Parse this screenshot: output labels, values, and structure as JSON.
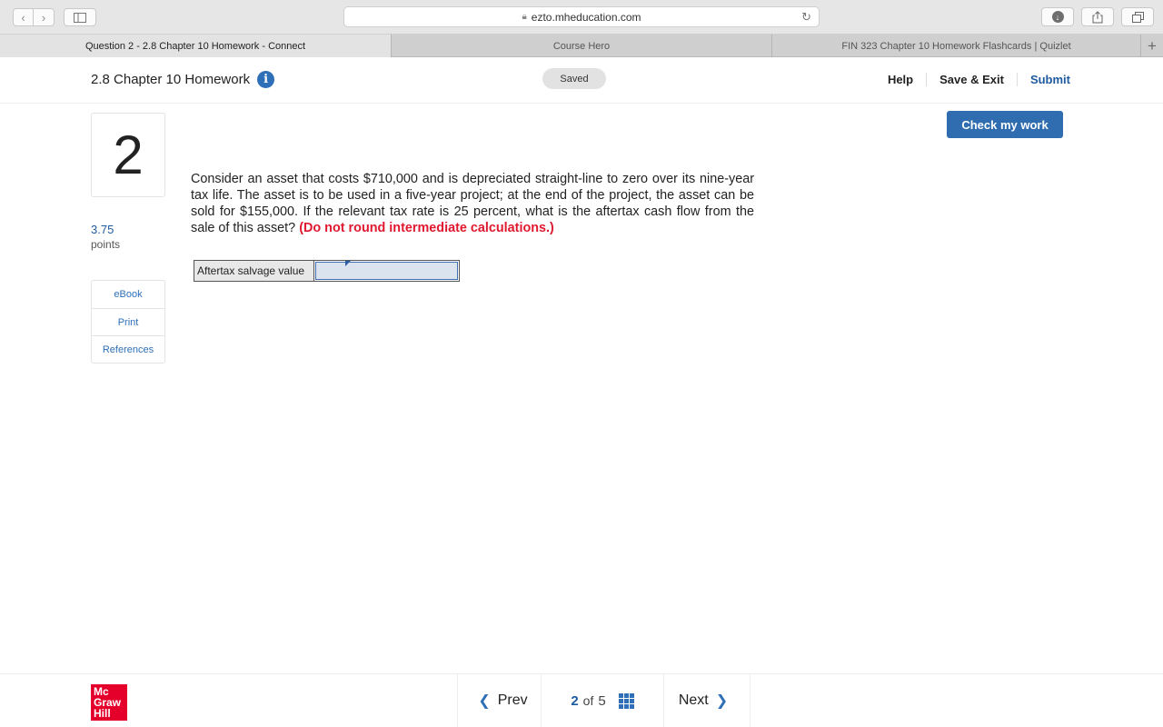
{
  "browser": {
    "url": "ezto.mheducation.com",
    "tabs": [
      {
        "label": "Question 2 - 2.8 Chapter 10 Homework - Connect",
        "active": true
      },
      {
        "label": "Course Hero",
        "active": false
      },
      {
        "label": "FIN 323 Chapter 10 Homework Flashcards | Quizlet",
        "active": false
      }
    ],
    "new_tab": "+"
  },
  "header": {
    "title": "2.8 Chapter 10 Homework",
    "status": "Saved",
    "help": "Help",
    "save_exit": "Save & Exit",
    "submit": "Submit"
  },
  "question": {
    "number": "2",
    "points_value": "3.75",
    "points_label": "points",
    "text": "Consider an asset that costs $710,000 and is depreciated straight-line to zero over its nine-year tax life. The asset is to be used in a five-year project; at the end of the project, the asset can be sold for $155,000. If the relevant tax rate is 25 percent, what is the aftertax cash flow from the sale of this asset?",
    "warning": "(Do not round intermediate calculations.)",
    "answer_label": "Aftertax salvage value",
    "answer_value": "",
    "check_button": "Check my work"
  },
  "resources": [
    "eBook",
    "Print",
    "References"
  ],
  "footer": {
    "logo_lines": [
      "Mc",
      "Graw",
      "Hill"
    ],
    "prev": "Prev",
    "current": "2",
    "of": "of",
    "total": "5",
    "next": "Next"
  },
  "colors": {
    "accent": "#2f6db0",
    "warning": "#e0192f",
    "brand_red": "#e4002b"
  }
}
